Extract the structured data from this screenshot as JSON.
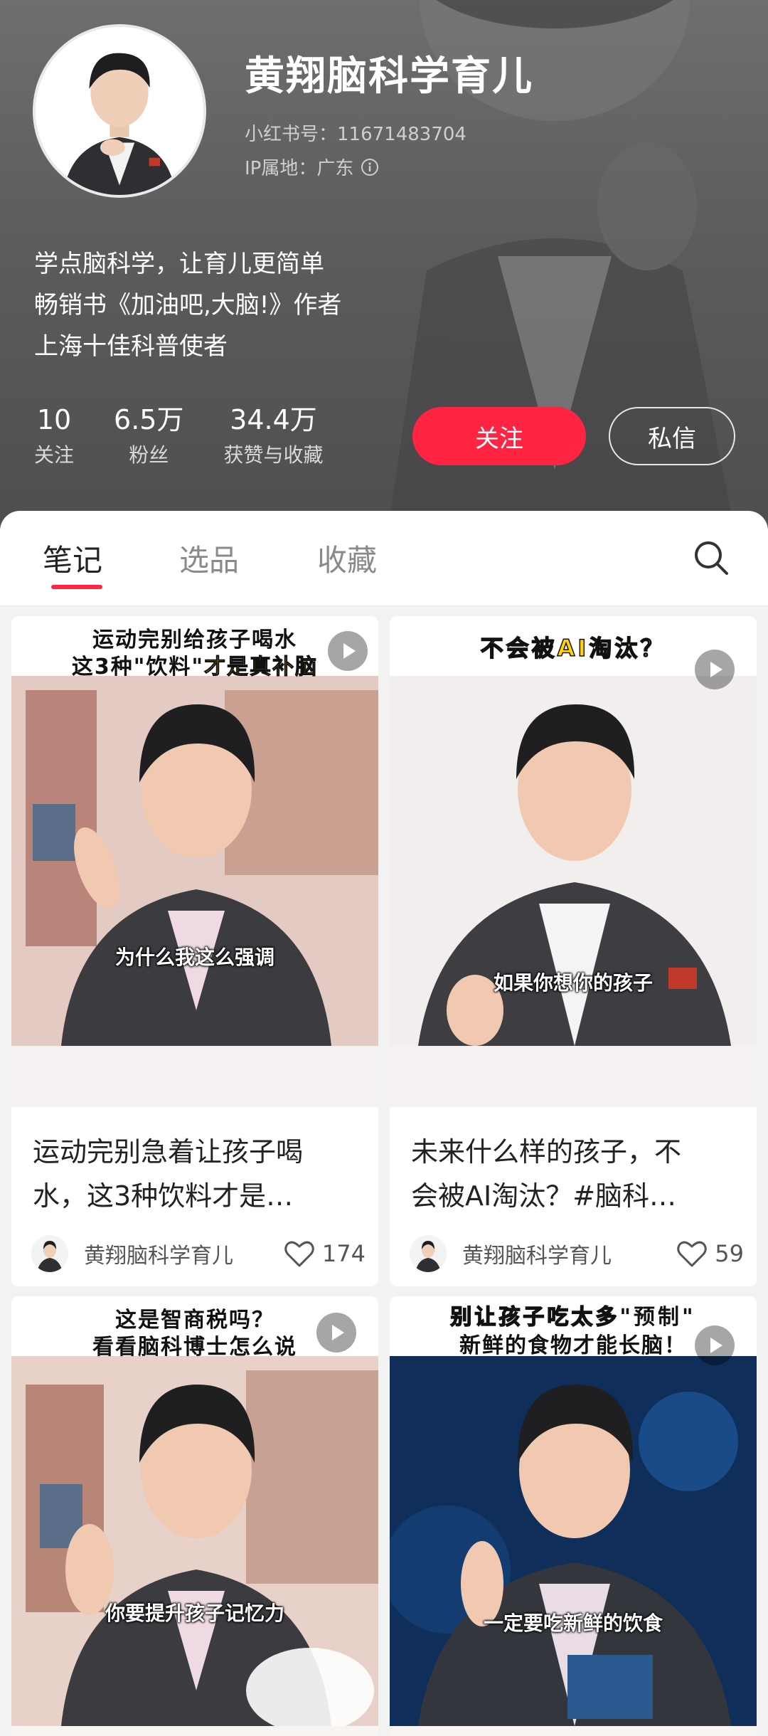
{
  "profile": {
    "nickname": "黄翔脑科学育儿",
    "red_id": "小红书号：11671483704",
    "ip_location": "IP属地：广东",
    "bio": [
      "学点脑科学，让育儿更简单",
      "畅销书《加油吧,大脑!》作者",
      "上海十佳科普使者"
    ],
    "stats": [
      {
        "value": "10",
        "label": "关注"
      },
      {
        "value": "6.5万",
        "label": "粉丝"
      },
      {
        "value": "34.4万",
        "label": "获赞与收藏"
      }
    ],
    "follow_label": "关注",
    "message_label": "私信"
  },
  "tabs": [
    {
      "label": "笔记",
      "active": true
    },
    {
      "label": "选品",
      "active": false
    },
    {
      "label": "收藏",
      "active": false
    }
  ],
  "colors": {
    "accent": "#ff2442",
    "header_bg": "#5c5c5e"
  },
  "icons": {
    "search": "search-icon",
    "play": "play-icon",
    "like": "heart-icon",
    "info": "info-icon"
  },
  "notes": [
    {
      "cover_text": [
        "运动完别给孩子喝水",
        "这3种\"饮料\"",
        "才是真补脑"
      ],
      "subtitle": "为什么我这么强调",
      "title": [
        "运动完别急着让孩子喝",
        "水，这3种饮料才是…"
      ],
      "author": "黄翔脑科学育儿",
      "likes": "174"
    },
    {
      "cover_text": [
        "不会被AI淘汰？"
      ],
      "subtitle": "如果你想你的孩子",
      "title": [
        "未来什么样的孩子，不",
        "会被AI淘汰？#脑科…"
      ],
      "author": "黄翔脑科学育儿",
      "likes": "59"
    },
    {
      "cover_text": [
        "这是智商税吗？",
        "看看脑科博士怎么说"
      ],
      "subtitle": "你要提升孩子记忆力"
    },
    {
      "cover_text": [
        "别让孩子吃太多",
        "\"预制\"",
        "新鲜的食物才能长脑！"
      ],
      "subtitle": "一定要吃新鲜的饮食"
    }
  ]
}
